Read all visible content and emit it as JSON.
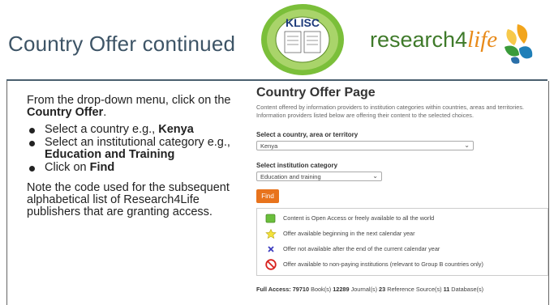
{
  "slide": {
    "title": "Country Offer continued",
    "logo_klisc": "KLISC",
    "logo_r4l_plain": "research4",
    "logo_r4l_italic": "life"
  },
  "instructions": {
    "intro_pre": "From the drop-down menu, click on the ",
    "intro_bold": "Country Offer",
    "intro_post": ".",
    "bullets": [
      {
        "pre": "Select a country e.g., ",
        "bold": "Kenya"
      },
      {
        "pre": "Select an institutional category e.g., ",
        "bold": "Education and Training"
      },
      {
        "pre": "Click on ",
        "bold": "Find"
      }
    ],
    "note": "Note the code used for the subsequent alphabetical list of Research4Life publishers that are granting access."
  },
  "screenshot": {
    "page_title": "Country Offer Page",
    "description_1": "Content offered by information providers to institution categories within countries, areas and territories.",
    "description_2": "Information providers listed below are offering their content to the selected choices.",
    "country_label": "Select a country, area or territory",
    "country_value": "Kenya",
    "category_label": "Select institution category",
    "category_value": "Education and training",
    "find_label": "Find",
    "legend": [
      {
        "icon": "open-access-square-icon",
        "text": "Content is Open Access or freely available to all the world"
      },
      {
        "icon": "star-icon",
        "text": "Offer available beginning in the next calendar year"
      },
      {
        "icon": "cross-icon",
        "text": "Offer not available after the end of the current calendar year"
      },
      {
        "icon": "no-symbol-icon",
        "text": "Offer available to non-paying institutions (relevant to Group B countries only)"
      }
    ],
    "totals": {
      "label": "Full Access: ",
      "books": "79710",
      "books_unit": " Book(s) ",
      "journals": "12289",
      "journals_unit": " Journal(s) ",
      "refs": "23",
      "refs_unit": " Reference Source(s) ",
      "dbs": "11",
      "dbs_unit": " Database(s)"
    }
  },
  "colors": {
    "title": "#3d5466",
    "find_button": "#e8731c",
    "r4l_green": "#3f7a2a",
    "r4l_orange": "#e88a1a"
  }
}
